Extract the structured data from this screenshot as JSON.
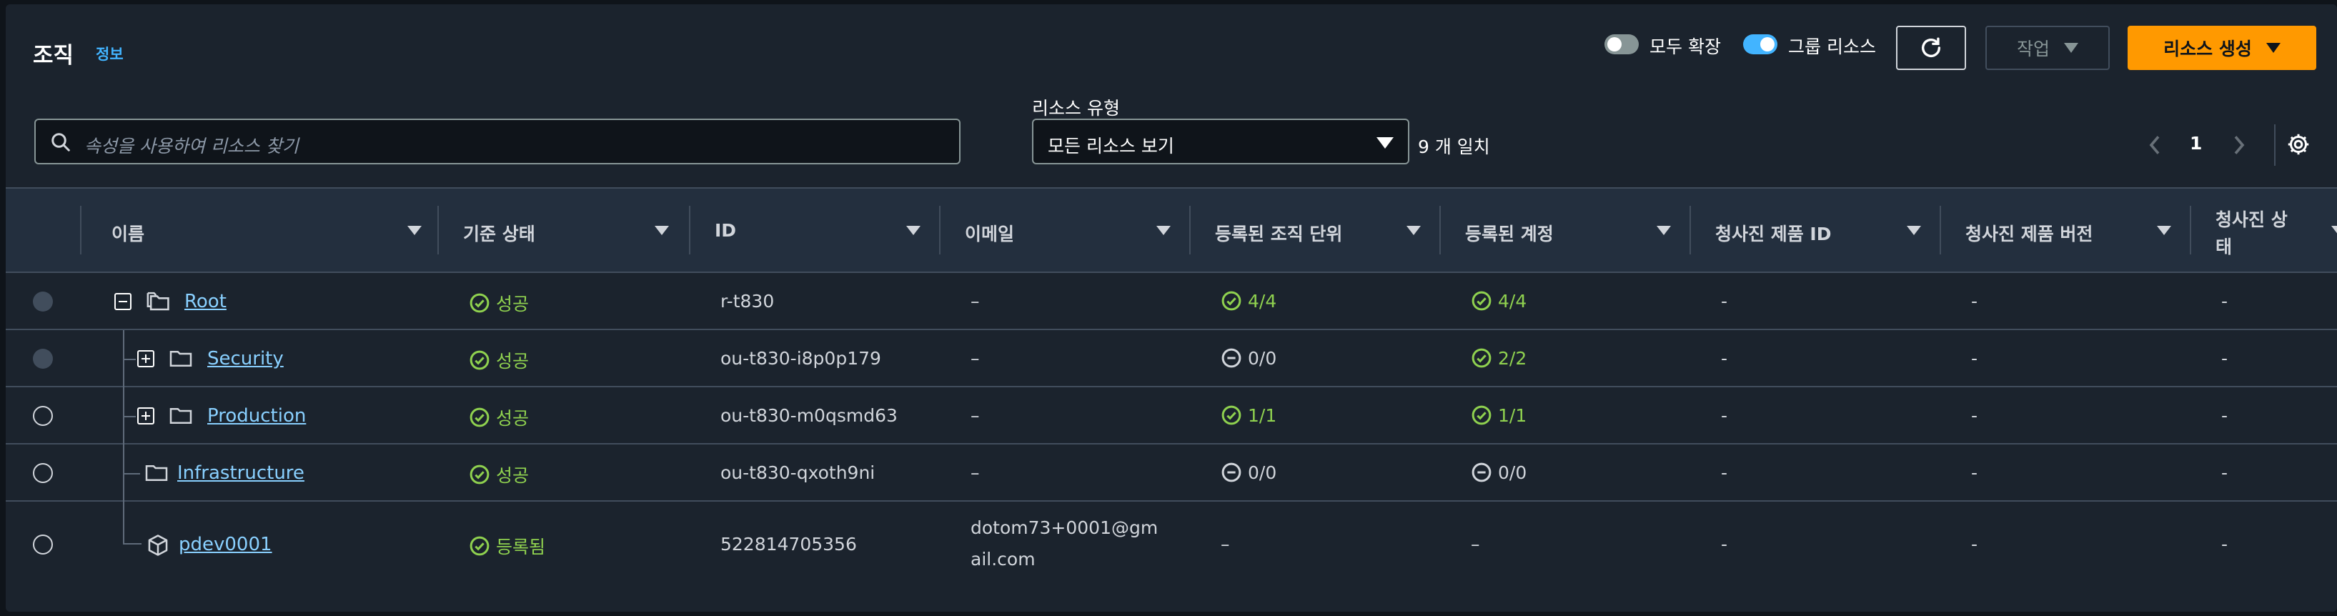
{
  "header": {
    "title": "조직",
    "info": "정보",
    "toggle_expand_all": "모두 확장",
    "toggle_group_resources": "그룹 리소스",
    "actions_label": "작업",
    "create_label": "리소스 생성"
  },
  "filter": {
    "search_placeholder": "속성을 사용하여 리소스 찾기",
    "resource_type_label": "리소스 유형",
    "resource_type_value": "모든 리소스 보기",
    "match_count": "9 개 일치"
  },
  "pagination": {
    "current_page": "1"
  },
  "colors": {
    "accent": "#42b4ff",
    "create": "#ff9900",
    "success": "#8fd14f",
    "link": "#89d0ff"
  },
  "table": {
    "columns": [
      "이름",
      "기준 상태",
      "ID",
      "이메일",
      "등록된 조직 단위",
      "등록된 계정",
      "청사진 제품 ID",
      "청사진 제품 버전",
      "청사진 상태"
    ],
    "last_column_wrap": [
      "청사진 상",
      "태"
    ],
    "rows": [
      {
        "name": "Root",
        "baseline": "성공",
        "id": "r-t830",
        "email": "–",
        "ou": "4/4",
        "accounts": "4/4",
        "bp_id": "-",
        "bp_ver": "-",
        "bp_status": "-"
      },
      {
        "name": "Security",
        "baseline": "성공",
        "id": "ou-t830-i8p0p179",
        "email": "–",
        "ou": "0/0",
        "accounts": "2/2",
        "bp_id": "-",
        "bp_ver": "-",
        "bp_status": "-"
      },
      {
        "name": "Production",
        "baseline": "성공",
        "id": "ou-t830-m0qsmd63",
        "email": "–",
        "ou": "1/1",
        "accounts": "1/1",
        "bp_id": "-",
        "bp_ver": "-",
        "bp_status": "-"
      },
      {
        "name": "Infrastructure",
        "baseline": "성공",
        "id": "ou-t830-qxoth9ni",
        "email": "–",
        "ou": "0/0",
        "accounts": "0/0",
        "bp_id": "-",
        "bp_ver": "-",
        "bp_status": "-"
      },
      {
        "name": "pdev0001",
        "baseline": "등록됨",
        "id": "522814705356",
        "email_line1": "dotom73+0001@gm",
        "email_line2": "ail.com",
        "ou": "–",
        "accounts": "–",
        "bp_id": "-",
        "bp_ver": "-",
        "bp_status": "-"
      }
    ]
  }
}
